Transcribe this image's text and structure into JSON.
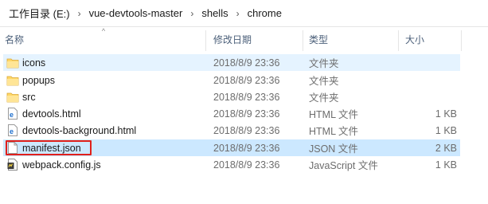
{
  "breadcrumb": [
    "工作目录 (E:)",
    "vue-devtools-master",
    "shells",
    "chrome"
  ],
  "breadcrumb_separator": "›",
  "columns": {
    "name": "名称",
    "date": "修改日期",
    "type": "类型",
    "size": "大小"
  },
  "sort_indicator": "^",
  "files": [
    {
      "name": "icons",
      "date": "2018/8/9 23:36",
      "type": "文件夹",
      "size": "",
      "icon": "folder-icon"
    },
    {
      "name": "popups",
      "date": "2018/8/9 23:36",
      "type": "文件夹",
      "size": "",
      "icon": "folder-icon"
    },
    {
      "name": "src",
      "date": "2018/8/9 23:36",
      "type": "文件夹",
      "size": "",
      "icon": "folder-icon"
    },
    {
      "name": "devtools.html",
      "date": "2018/8/9 23:36",
      "type": "HTML 文件",
      "size": "1 KB",
      "icon": "html-file-icon"
    },
    {
      "name": "devtools-background.html",
      "date": "2018/8/9 23:36",
      "type": "HTML 文件",
      "size": "1 KB",
      "icon": "html-file-icon"
    },
    {
      "name": "manifest.json",
      "date": "2018/8/9 23:36",
      "type": "JSON 文件",
      "size": "2 KB",
      "icon": "json-file-icon"
    },
    {
      "name": "webpack.config.js",
      "date": "2018/8/9 23:36",
      "type": "JavaScript 文件",
      "size": "1 KB",
      "icon": "js-file-icon"
    }
  ],
  "colors": {
    "hover_row": "#e5f3ff",
    "selected_row": "#cce8ff",
    "highlight_box": "#e0201b",
    "folder": "#ffd766",
    "edge_blue": "#1e6fce"
  }
}
